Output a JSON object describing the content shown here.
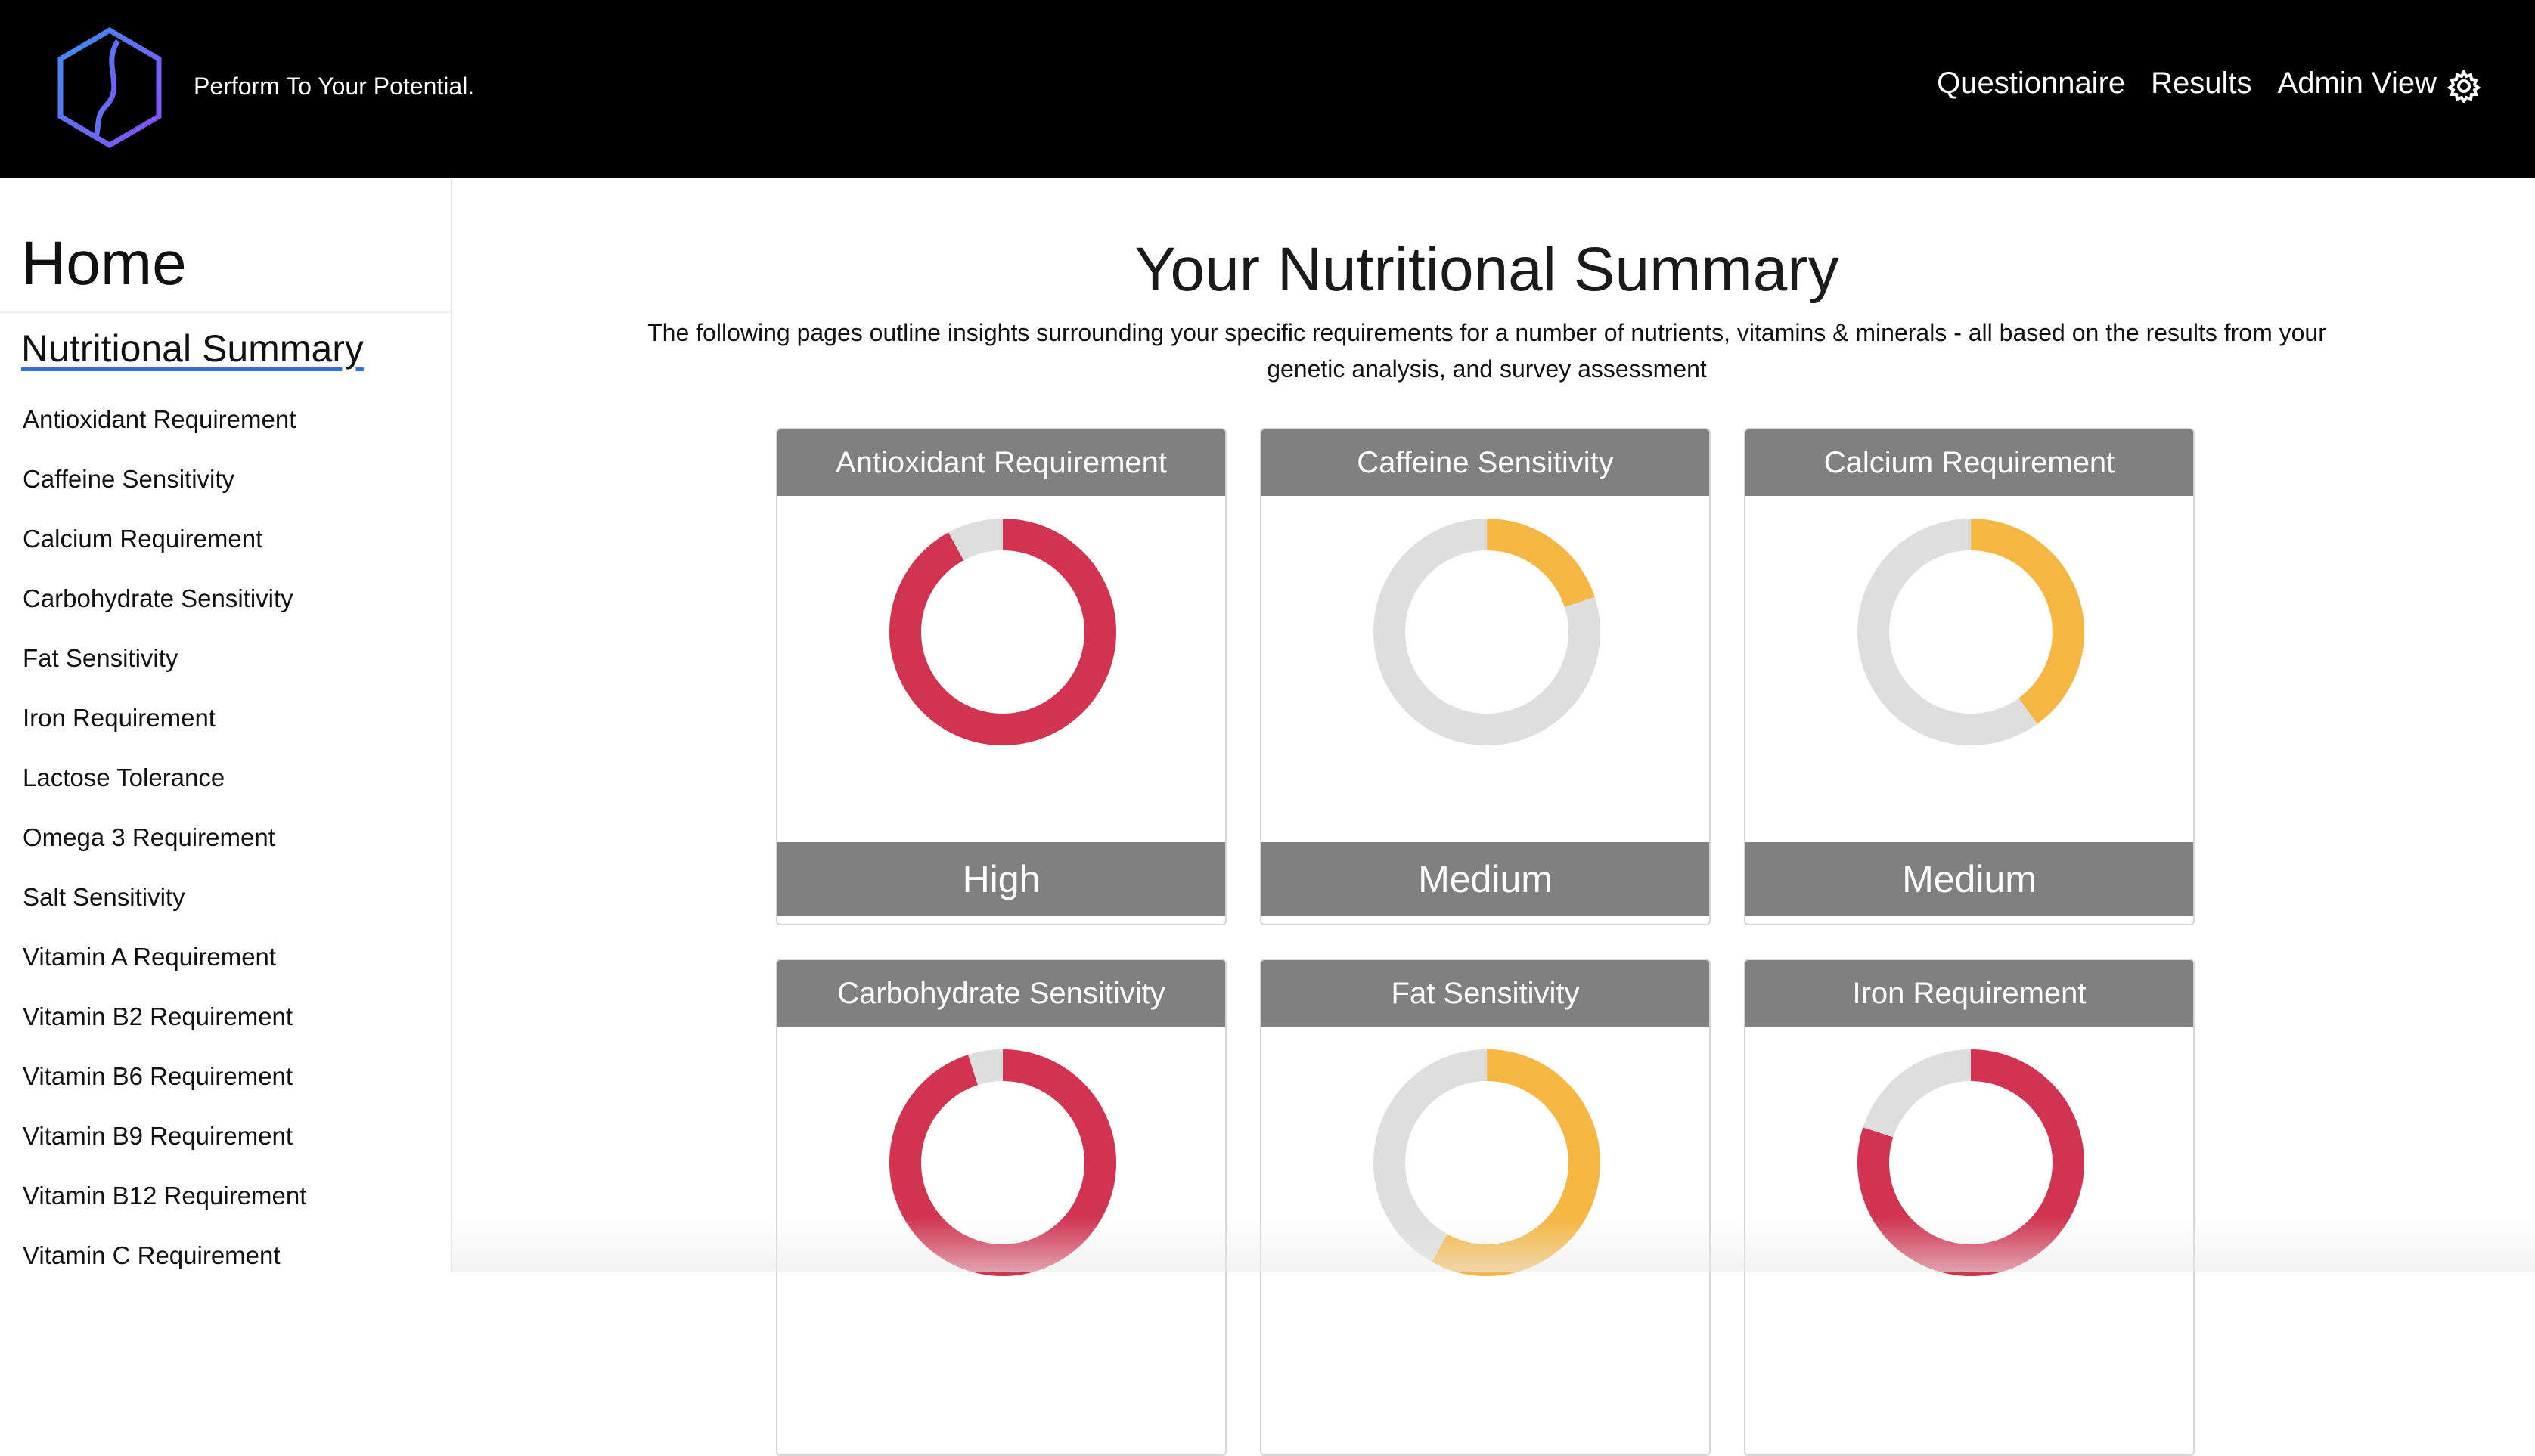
{
  "header": {
    "tagline": "Perform To Your Potential.",
    "nav": [
      "Questionnaire",
      "Results",
      "Admin View"
    ],
    "settings_icon": "gear-icon",
    "logo_icon": "dna-hexagon-logo"
  },
  "sidebar": {
    "title": "Home",
    "section": "Nutritional Summary",
    "items": [
      "Antioxidant Requirement",
      "Caffeine Sensitivity",
      "Calcium Requirement",
      "Carbohydrate Sensitivity",
      "Fat Sensitivity",
      "Iron Requirement",
      "Lactose Tolerance",
      "Omega 3 Requirement",
      "Salt Sensitivity",
      "Vitamin A Requirement",
      "Vitamin B2 Requirement",
      "Vitamin B6 Requirement",
      "Vitamin B9 Requirement",
      "Vitamin B12 Requirement",
      "Vitamin C Requirement"
    ]
  },
  "main": {
    "title": "Your Nutritional Summary",
    "intro": "The following pages outline insights surrounding your specific requirements for a number of nutrients, vitamins & minerals - all based on the results from your genetic analysis, and survey assessment",
    "cards": [
      {
        "title": "Antioxidant Requirement",
        "level": "High",
        "fill": 0.92,
        "color": "#d13350"
      },
      {
        "title": "Caffeine Sensitivity",
        "level": "Medium",
        "fill": 0.2,
        "color": "#f5b642"
      },
      {
        "title": "Calcium Requirement",
        "level": "Medium",
        "fill": 0.4,
        "color": "#f5b642"
      },
      {
        "title": "Carbohydrate Sensitivity",
        "level": "",
        "fill": 0.95,
        "color": "#d13350"
      },
      {
        "title": "Fat Sensitivity",
        "level": "",
        "fill": 0.58,
        "color": "#f5b642"
      },
      {
        "title": "Iron Requirement",
        "level": "",
        "fill": 0.8,
        "color": "#d13350"
      }
    ]
  },
  "colors": {
    "track": "#dedede",
    "high": "#d13350",
    "medium": "#f5b642",
    "header_bg": "#000000",
    "card_band": "#808080"
  }
}
